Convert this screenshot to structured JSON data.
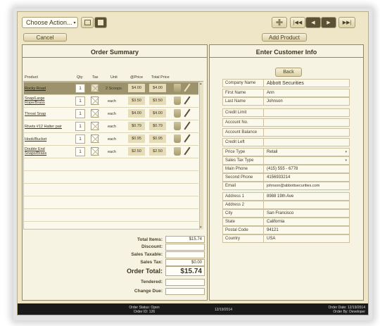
{
  "toolbar": {
    "choose_action": "Choose Action...",
    "cancel": "Cancel",
    "add_product": "Add Product"
  },
  "order_summary": {
    "title": "Order Summary",
    "columns": [
      "Product",
      "Qty",
      "Tax",
      "Unit",
      "@Price",
      "Total Price"
    ],
    "rows": [
      {
        "product": "Rocky Road",
        "qty": "1",
        "unit": "2 Scoops",
        "price": "$4.00",
        "total": "$4.00"
      },
      {
        "product": "Snap/Large Rope/Brass",
        "qty": "1",
        "unit": "each",
        "price": "$3.50",
        "total": "$3.50"
      },
      {
        "product": "Throat Snap",
        "qty": "1",
        "unit": "each",
        "price": "$4.00",
        "total": "$4.00"
      },
      {
        "product": "Rivets #12 Halter pair",
        "qty": "1",
        "unit": "each",
        "price": "$0.79",
        "total": "$0.79"
      },
      {
        "product": "Hook/Bucket",
        "qty": "1",
        "unit": "each",
        "price": "$0.95",
        "total": "$0.95"
      },
      {
        "product": "Double End Snaps/Brass",
        "qty": "1",
        "unit": "each",
        "price": "$2.50",
        "total": "$2.50"
      }
    ]
  },
  "totals": {
    "total_items_label": "Total Items:",
    "total_items": "$15.74",
    "discount_label": "Discount:",
    "sales_taxable_label": "Sales Taxable:",
    "sales_tax_label": "Sales Tax:",
    "sales_tax": "$0.00",
    "order_total_label": "Order Total:",
    "order_total": "$15.74",
    "tendered_label": "Tendered:",
    "change_due_label": "Change Due:"
  },
  "customer": {
    "title": "Enter Customer Info",
    "back": "Back",
    "fields": [
      {
        "label": "Company Name",
        "value": "Abbott Securities"
      },
      {
        "label": "First Name",
        "value": "Ann"
      },
      {
        "label": "Last Name",
        "value": "Johnson"
      },
      {
        "label": "Credit Limit",
        "value": ""
      },
      {
        "label": "Account No.",
        "value": ""
      },
      {
        "label": "Account Balance",
        "value": ""
      },
      {
        "label": "Credit Left",
        "value": ""
      },
      {
        "label": "Price Type",
        "value": "Retail"
      },
      {
        "label": "Sales Tax Type",
        "value": ""
      },
      {
        "label": "Main Phone",
        "value": "(415) 555 - 6778"
      },
      {
        "label": "Second Phone",
        "value": "4156933214"
      },
      {
        "label": "Email",
        "value": "johnson@abbottsecurities.com"
      },
      {
        "label": "Address 1",
        "value": "8988 19th Ave"
      },
      {
        "label": "Address 2",
        "value": ""
      },
      {
        "label": "City",
        "value": "San Francisco"
      },
      {
        "label": "State",
        "value": "California"
      },
      {
        "label": "Postal Code",
        "value": "94121"
      },
      {
        "label": "Country",
        "value": "USA"
      }
    ]
  },
  "footer": {
    "status": "Order Status: Open",
    "order_id": "Order ID: 126",
    "center_date": "12/19/2014",
    "order_date": "Order Date: 12/19/2014",
    "order_by": "Order By: Developer"
  },
  "icons": [
    "list-view-icon",
    "card-view-icon",
    "plus-icon",
    "first-icon",
    "prev-icon",
    "next-icon",
    "last-icon",
    "trash-icon",
    "pencil-icon"
  ]
}
